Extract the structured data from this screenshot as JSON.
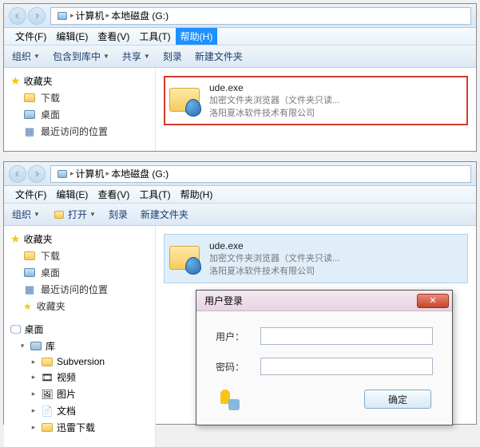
{
  "window1": {
    "breadcrumb": {
      "seg1": "计算机",
      "seg2": "本地磁盘 (G:)"
    },
    "menus": {
      "file": "文件(F)",
      "edit": "编辑(E)",
      "view": "查看(V)",
      "tools": "工具(T)",
      "help": "帮助(H)"
    },
    "toolbar": {
      "organize": "组织",
      "include": "包含到库中",
      "share": "共享",
      "burn": "刻录",
      "newfolder": "新建文件夹"
    },
    "sidebar": {
      "favorites": "收藏夹",
      "downloads": "下载",
      "desktop": "桌面",
      "recent": "最近访问的位置"
    },
    "file": {
      "name": "ude.exe",
      "desc": "加密文件夹浏览器（文件夹只读...",
      "company": "洛阳夏冰软件技术有限公司"
    }
  },
  "window2": {
    "breadcrumb": {
      "seg1": "计算机",
      "seg2": "本地磁盘 (G:)"
    },
    "menus": {
      "file": "文件(F)",
      "edit": "编辑(E)",
      "view": "查看(V)",
      "tools": "工具(T)",
      "help": "帮助(H)"
    },
    "toolbar": {
      "organize": "组织",
      "open": "打开",
      "burn": "刻录",
      "newfolder": "新建文件夹"
    },
    "sidebar": {
      "favorites": "收藏夹",
      "downloads": "下载",
      "desktop": "桌面",
      "recent": "最近访问的位置",
      "favorites2": "收藏夹",
      "desktop_group": "桌面",
      "library": "库",
      "subversion": "Subversion",
      "videos": "视频",
      "pictures": "图片",
      "documents": "文档",
      "thunder": "迅雷下载"
    },
    "file": {
      "name": "ude.exe",
      "desc": "加密文件夹浏览器（文件夹只读...",
      "company": "洛阳夏冰软件技术有限公司"
    },
    "dialog": {
      "title": "用户登录",
      "user_label": "用户：",
      "pass_label": "密码：",
      "ok": "确定"
    }
  }
}
